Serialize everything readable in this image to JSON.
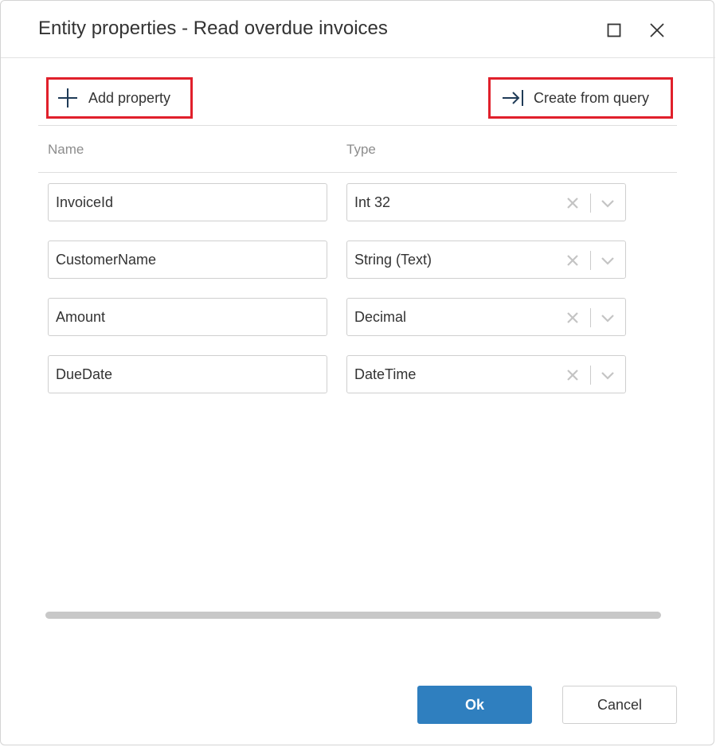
{
  "dialog": {
    "title": "Entity properties - Read overdue invoices",
    "maximize_icon": "maximize-icon",
    "close_icon": "close-icon"
  },
  "toolbar": {
    "add_property_label": "Add property",
    "add_property_icon": "plus-icon",
    "create_from_query_label": "Create from query",
    "create_from_query_icon": "arrow-right-to-bar-icon",
    "highlight_color": "#e0202b"
  },
  "columns": {
    "name": "Name",
    "type": "Type"
  },
  "properties": [
    {
      "name": "InvoiceId",
      "type": "Int 32"
    },
    {
      "name": "CustomerName",
      "type": "String (Text)"
    },
    {
      "name": "Amount",
      "type": "Decimal"
    },
    {
      "name": "DueDate",
      "type": "DateTime"
    }
  ],
  "footer": {
    "ok_label": "Ok",
    "cancel_label": "Cancel",
    "ok_color": "#2f7fbf"
  }
}
